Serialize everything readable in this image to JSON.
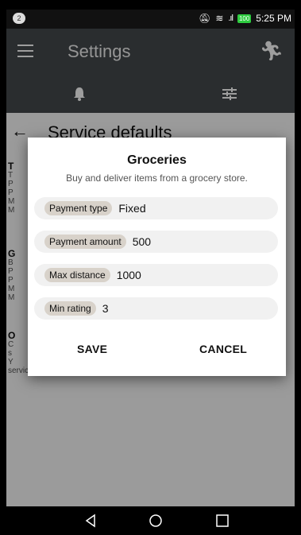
{
  "status_bar": {
    "notification_count": "2",
    "time": "5:25 PM",
    "battery_label": "100"
  },
  "app_bar": {
    "title": "Settings"
  },
  "page": {
    "title": "Service defaults",
    "sections": [
      {
        "heading": "T",
        "lines": [
          "T",
          "P",
          "P",
          "M",
          "M"
        ]
      },
      {
        "heading": "G",
        "lines": [
          "B",
          "P",
          "P",
          "M",
          "M"
        ]
      },
      {
        "heading": "O",
        "lines": [
          "C",
          "s",
          "Y",
          "service type."
        ]
      }
    ]
  },
  "dialog": {
    "title": "Groceries",
    "subtitle": "Buy and deliver items from a grocery store.",
    "fields": [
      {
        "label": "Payment type",
        "value": "Fixed"
      },
      {
        "label": "Payment amount",
        "value": "500"
      },
      {
        "label": "Max distance",
        "value": "1000"
      },
      {
        "label": "Min rating",
        "value": "3"
      }
    ],
    "save_label": "SAVE",
    "cancel_label": "CANCEL"
  },
  "icons": {
    "menu": "hamburger-menu-icon",
    "walk": "walking-person-icon",
    "bell": "bell-icon",
    "tune": "tune-sliders-icon",
    "back": "back-arrow-icon"
  }
}
